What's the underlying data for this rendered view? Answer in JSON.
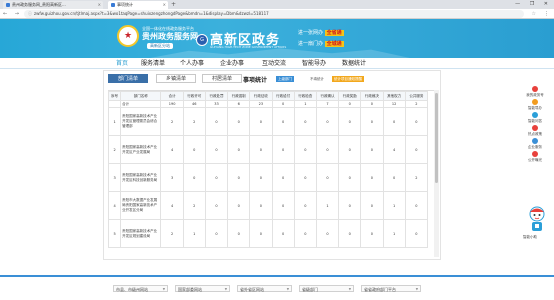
{
  "browser": {
    "tabs": [
      {
        "label": "贵州政务服务网_贵阳高新区..."
      },
      {
        "label": "事项统计"
      }
    ],
    "new_tab": "+",
    "window_controls": "— ❐ ✕",
    "nav": "← → ⟳",
    "url": "zwfw.guizhou.gov.cn/tjtlmaj.aspx?t=3&wo1taqPage=shuixzengzhongdPage&bmdn=1&display=Dbm&dzwzl=518117",
    "close": "×"
  },
  "banner": {
    "emblem": "★",
    "site_small": "全国一体化在线政务服务平台",
    "site_title": "贵州政务服务网",
    "site_sub": "高新区分站",
    "zone_logo": "G",
    "zone_title": "高新区政务",
    "zone_sub": "GUIYANG HIGH-TECH ZONE GOVERNMENT AFFAIRS",
    "slogan_row1_text": "进一张网办",
    "slogan_row1_hl": "全省通",
    "slogan_row2_text": "进一扇门办",
    "slogan_row2_hl": "全城通"
  },
  "mainnav": {
    "items": [
      "首页",
      "服务清单",
      "个人办事",
      "企业办事",
      "互动交流",
      "智能导办",
      "数据统计"
    ]
  },
  "panel": {
    "subtabs": [
      "部门清单",
      "乡镇清单",
      "村居清单"
    ],
    "stat_label": "事项统计",
    "legend": [
      "上级部门",
      "不填统计",
      "统计项目通知提醒"
    ],
    "columns": [
      "序号",
      "部门名称",
      "合计",
      "行政许可",
      "行政处罚",
      "行政强制",
      "行政征收",
      "行政给付",
      "行政检查",
      "行政确认",
      "行政奖励",
      "行政裁决",
      "其他权力",
      "公共服务"
    ],
    "rows": [
      {
        "no": "",
        "name": "合计",
        "vals": [
          "190",
          "46",
          "33",
          "6",
          "23",
          "0",
          "1",
          "7",
          "0",
          "0",
          "12",
          "2"
        ]
      },
      {
        "no": "1",
        "name": "贵阳国家高新技术产业开发区管理委员会综合管理部",
        "vals": [
          "2",
          "2",
          "0",
          "0",
          "0",
          "0",
          "0",
          "0",
          "0",
          "0",
          "0",
          "0"
        ]
      },
      {
        "no": "2",
        "name": "贵阳国家高新技术产业开发区产业发展局",
        "vals": [
          "4",
          "0",
          "0",
          "0",
          "0",
          "0",
          "0",
          "0",
          "0",
          "0",
          "4",
          "0"
        ]
      },
      {
        "no": "3",
        "name": "贵阳国家高新技术产业开发区科技创新服务局",
        "vals": [
          "3",
          "0",
          "0",
          "0",
          "0",
          "0",
          "0",
          "0",
          "0",
          "0",
          "0",
          "2"
        ]
      },
      {
        "no": "4",
        "name": "贵阳市大数据产业发展局贵阳国家高新技术产业开发区分局",
        "vals": [
          "4",
          "2",
          "0",
          "0",
          "0",
          "0",
          "0",
          "1",
          "0",
          "0",
          "1",
          "0"
        ]
      },
      {
        "no": "5",
        "name": "贵阳国家高新技术产业开发区规划建设局",
        "vals": [
          "2",
          "1",
          "0",
          "0",
          "0",
          "0",
          "0",
          "0",
          "0",
          "0",
          "1",
          "0"
        ]
      }
    ]
  },
  "floatbar": {
    "items": [
      {
        "label": "我的政务号",
        "icon": "user-icon",
        "color": "#e8413c"
      },
      {
        "label": "智能导办",
        "icon": "compass-icon",
        "color": "#f29c1f"
      },
      {
        "label": "智能问答",
        "icon": "chat-icon",
        "color": "#2b9fd8"
      },
      {
        "label": "热点政策",
        "icon": "fire-icon",
        "color": "#e8413c"
      },
      {
        "label": "企业服务",
        "icon": "briefcase-icon",
        "color": "#3a8fd6"
      },
      {
        "label": "公开曝光",
        "icon": "megaphone-icon",
        "color": "#e8413c"
      }
    ],
    "robot_label": "智能小助"
  },
  "footer": {
    "selects": [
      "市县、市级州网站",
      "国家部委网站",
      "省外省区网站",
      "省级部门",
      "省省政府部门平台"
    ]
  }
}
